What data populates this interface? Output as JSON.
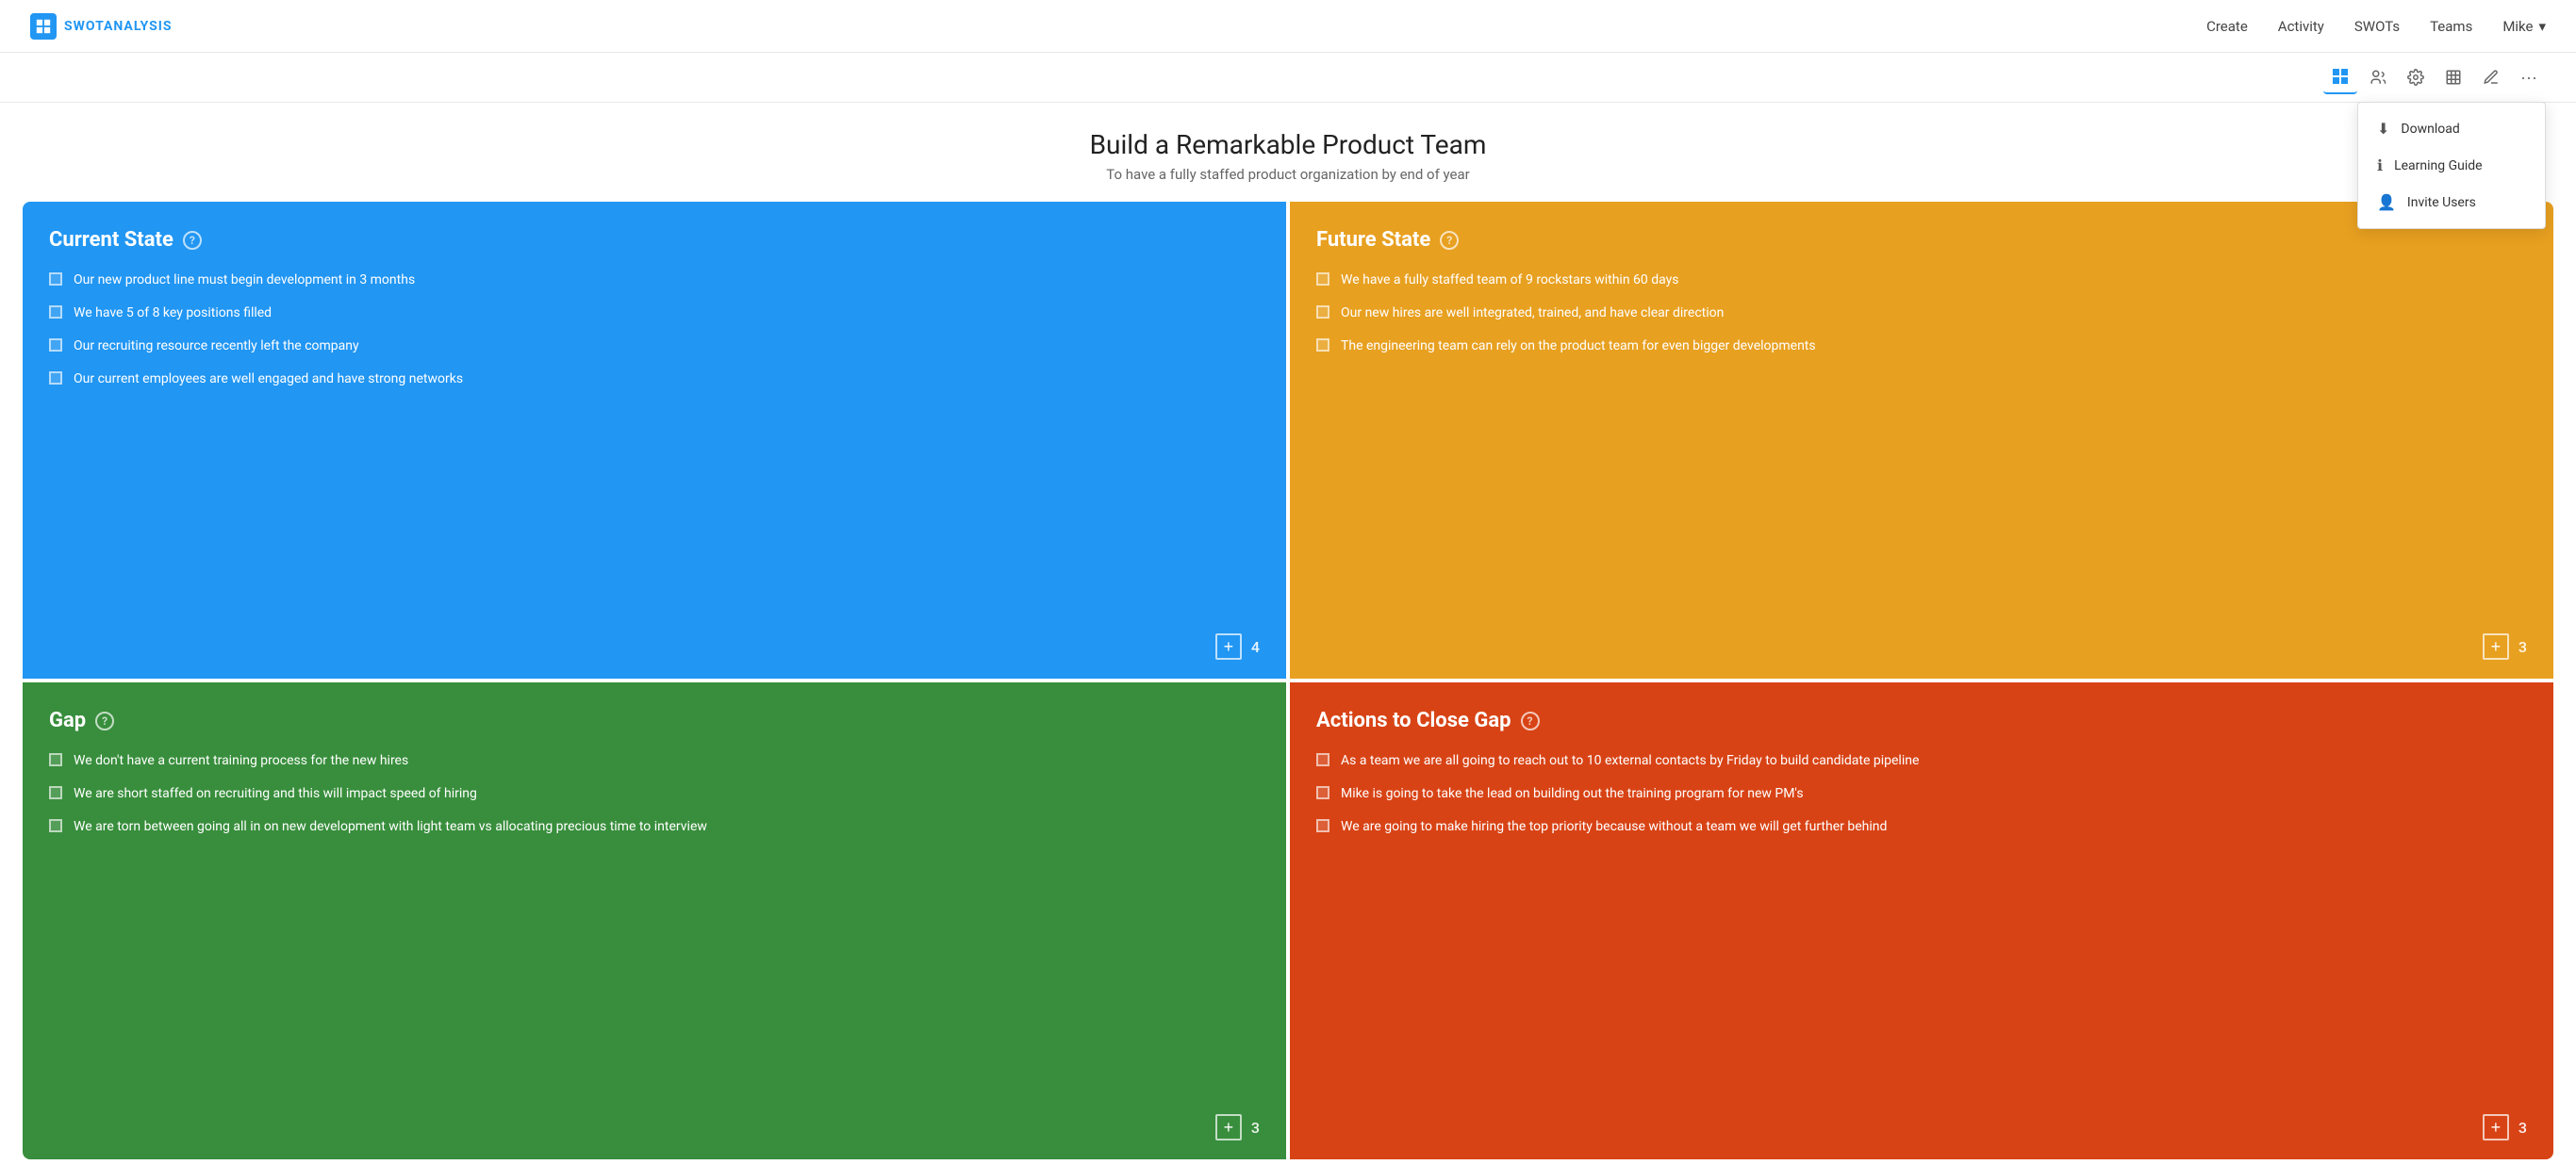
{
  "logo": {
    "text": "SWOTANALYSIS"
  },
  "nav": {
    "items": [
      "Create",
      "Activity",
      "SWOTs",
      "Teams"
    ],
    "user": "Mike"
  },
  "toolbar": {
    "buttons": [
      "grid-icon",
      "people-icon",
      "gear-icon",
      "frame-icon",
      "pencil-icon",
      "more-icon"
    ],
    "activeIndex": 0
  },
  "dropdown": {
    "items": [
      {
        "icon": "download-icon",
        "label": "Download"
      },
      {
        "icon": "info-icon",
        "label": "Learning Guide"
      },
      {
        "icon": "user-icon",
        "label": "Invite Users"
      }
    ]
  },
  "page": {
    "title": "Build a Remarkable Product Team",
    "subtitle": "To have a fully staffed product organization by end of year"
  },
  "quadrants": {
    "current": {
      "title": "Current State",
      "items": [
        "Our new product line must begin development in 3 months",
        "We have 5 of 8 key positions filled",
        "Our recruiting resource recently left the company",
        "Our current employees are well engaged and have strong networks"
      ],
      "count": "4"
    },
    "future": {
      "title": "Future State",
      "items": [
        "We have a fully staffed team of 9 rockstars within 60 days",
        "Our new hires are well integrated, trained, and have clear direction",
        "The engineering team can rely on the product team for even bigger developments"
      ],
      "count": "3"
    },
    "gap": {
      "title": "Gap",
      "items": [
        "We don't have a current training process for the new hires",
        "We are short staffed on recruiting and this will impact speed of hiring",
        "We are torn between going all in on new development with light team vs allocating precious time to interview"
      ],
      "count": "3"
    },
    "actions": {
      "title": "Actions to Close Gap",
      "items": [
        "As a team we are all going to reach out to 10 external contacts by Friday to build candidate pipeline",
        "Mike is going to take the lead on building out the training program for new PM's",
        "We are going to make hiring the top priority because without a team we will get further behind"
      ],
      "count": "3"
    }
  },
  "buttons": {
    "add_label": "+"
  }
}
